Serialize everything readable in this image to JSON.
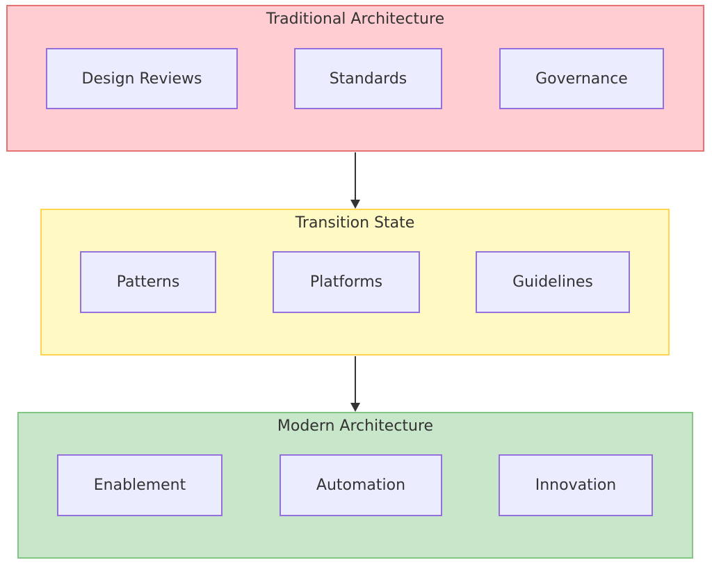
{
  "diagram": {
    "type": "flowchart",
    "groups": [
      {
        "id": "traditional",
        "title": "Traditional Architecture",
        "fill": "#FFCDD2",
        "stroke": "#E57373",
        "nodes": [
          "Design Reviews",
          "Standards",
          "Governance"
        ]
      },
      {
        "id": "transition",
        "title": "Transition State",
        "fill": "#FFF9C4",
        "stroke": "#FFD54F",
        "nodes": [
          "Patterns",
          "Platforms",
          "Guidelines"
        ]
      },
      {
        "id": "modern",
        "title": "Modern Architecture",
        "fill": "#C8E6C9",
        "stroke": "#81C784",
        "nodes": [
          "Enablement",
          "Automation",
          "Innovation"
        ]
      }
    ],
    "edges": [
      {
        "from": "traditional",
        "to": "transition"
      },
      {
        "from": "transition",
        "to": "modern"
      }
    ]
  }
}
